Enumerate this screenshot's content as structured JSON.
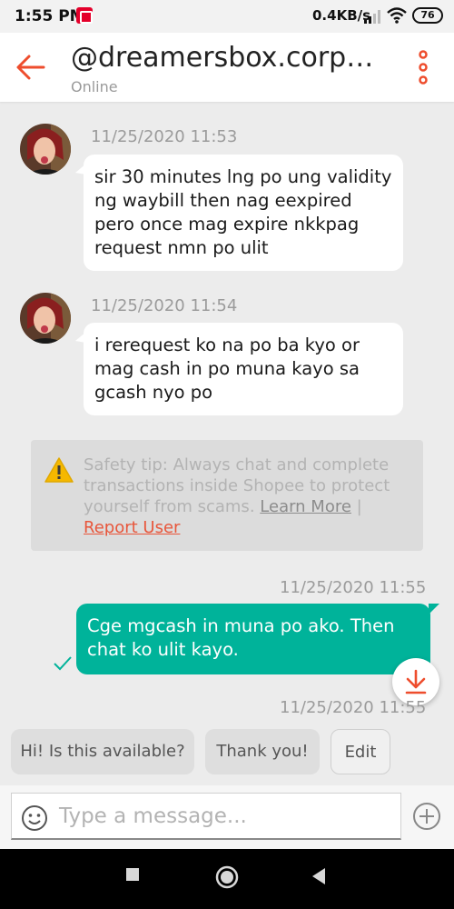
{
  "status_bar": {
    "time": "1:55 PM",
    "network_speed": "0.4KB/s",
    "battery": "76"
  },
  "header": {
    "back_icon": "arrow-left-icon",
    "title": "@dreamersbox.corpor...",
    "subtitle": "Online",
    "menu_icon": "more-vertical-icon",
    "accent_color": "#ee4d2d"
  },
  "messages": [
    {
      "direction": "incoming",
      "timestamp": "11/25/2020 11:53",
      "text": "sir 30 minutes lng po ung validity ng waybill then nag eexpired pero once mag expire nkkpag request nmn po ulit"
    },
    {
      "direction": "incoming",
      "timestamp": "11/25/2020 11:54",
      "text": "i rerequest ko na po ba kyo or mag cash in po muna kayo sa gcash nyo po"
    },
    {
      "direction": "outgoing",
      "timestamp": "11/25/2020 11:55",
      "text": "Cge mgcash in muna po ako. Then chat ko ulit kayo.",
      "status_icon": "check-icon"
    }
  ],
  "trailing_timestamp": "11/25/2020 11:55",
  "safety_tip": {
    "text": "Safety tip: Always chat and complete transactions inside Shopee to protect yourself from scams.",
    "learn_more": "Learn More",
    "separator": "|",
    "report": "Report User",
    "icon": "warning-icon"
  },
  "quick_replies": {
    "items": [
      "Hi! Is this available?",
      "Thank you!"
    ],
    "edit": "Edit"
  },
  "composer": {
    "placeholder": "Type a message...",
    "emoji_icon": "emoji-icon",
    "add_icon": "plus-circle-icon"
  },
  "colors": {
    "outgoing_bubble": "#00b39a",
    "incoming_bubble": "#ffffff",
    "background": "#ececec",
    "link": "#e8563b"
  }
}
